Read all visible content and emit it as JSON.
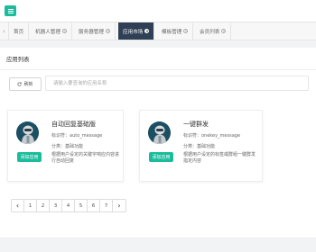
{
  "tabs": [
    {
      "label": "首页",
      "closable": false,
      "active": false
    },
    {
      "label": "机器人管理",
      "closable": true,
      "active": false
    },
    {
      "label": "服务器管理",
      "closable": true,
      "active": false
    },
    {
      "label": "应用市场",
      "closable": true,
      "active": true
    },
    {
      "label": "模板管理",
      "closable": true,
      "active": false
    },
    {
      "label": "会员列表",
      "closable": true,
      "active": false
    }
  ],
  "panel": {
    "title": "应用列表"
  },
  "toolbar": {
    "refresh_label": "刷新",
    "search_placeholder": "请输入要查询的应用名称"
  },
  "apps": [
    {
      "name": "自动回复基础版",
      "identifier": "标识符：auto_message",
      "category": "分类：基础功能",
      "description": "根据用户设定的关键字响应内容进行自动回复",
      "add_label": "添加应用"
    },
    {
      "name": "一键群发",
      "identifier": "标识符：onekey_message",
      "category": "分类：基础功能",
      "description": "根据用户设定的标签或群组一键群发指定内容",
      "add_label": "添加应用"
    }
  ],
  "pagination": {
    "prev": "‹",
    "pages": [
      "1",
      "2",
      "3",
      "4",
      "5",
      "6",
      "7"
    ],
    "next": "›"
  },
  "colors": {
    "accent": "#1abc9c",
    "active_tab": "#2f4056"
  }
}
